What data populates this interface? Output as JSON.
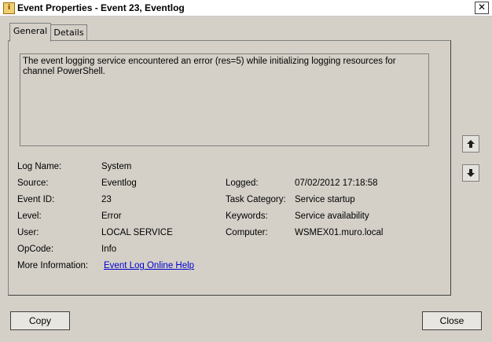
{
  "window": {
    "title": "Event Properties - Event 23, Eventlog",
    "close_glyph": "✕"
  },
  "tabs": [
    {
      "label": "General",
      "active": true
    },
    {
      "label": "Details",
      "active": false
    }
  ],
  "description": "The event logging service encountered an error (res=5) while initializing logging resources for channel PowerShell.",
  "fields": {
    "log_name": {
      "label": "Log Name:",
      "value": "System"
    },
    "source": {
      "label": "Source:",
      "value": "Eventlog"
    },
    "event_id": {
      "label": "Event ID:",
      "value": "23"
    },
    "level": {
      "label": "Level:",
      "value": "Error"
    },
    "user": {
      "label": "User:",
      "value": "LOCAL SERVICE"
    },
    "opcode": {
      "label": "OpCode:",
      "value": "Info"
    },
    "more_info": {
      "label": "More Information:",
      "value": "Event Log Online Help"
    },
    "logged": {
      "label": "Logged:",
      "value": "07/02/2012 17:18:58"
    },
    "task_category": {
      "label": "Task Category:",
      "value": "Service startup"
    },
    "keywords": {
      "label": "Keywords:",
      "value": "Service availability"
    },
    "computer": {
      "label": "Computer:",
      "value": "WSMEX01.muro.local"
    }
  },
  "buttons": {
    "copy": "Copy",
    "close": "Close"
  },
  "icons": {
    "app": "event-viewer-icon",
    "up": "arrow-up-icon",
    "down": "arrow-down-icon"
  }
}
